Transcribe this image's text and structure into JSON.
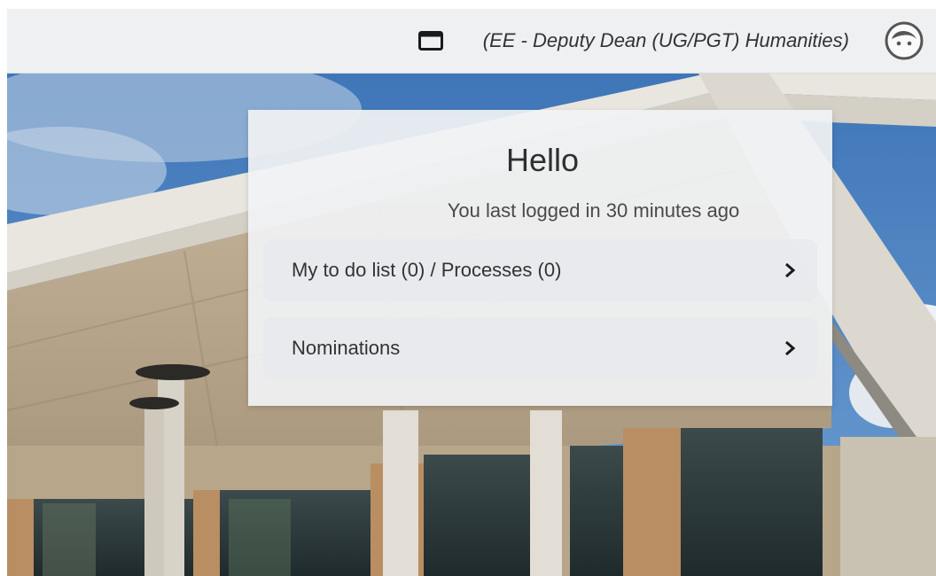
{
  "header": {
    "role_label": "(EE - Deputy Dean (UG/PGT) Humanities)",
    "icons": {
      "window": "window-icon",
      "avatar": "avatar-face-icon"
    }
  },
  "welcome": {
    "greeting": "Hello",
    "last_login": "You last logged in 30 minutes ago"
  },
  "menu": {
    "items": [
      {
        "label": "My to do list (0) / Processes (0)",
        "icon": "chevron-right-icon"
      },
      {
        "label": "Nominations",
        "icon": "chevron-right-icon"
      }
    ]
  },
  "colors": {
    "topbar_bg": "#eef0f2",
    "card_bg": "#f0f2f4",
    "text": "#333333"
  }
}
